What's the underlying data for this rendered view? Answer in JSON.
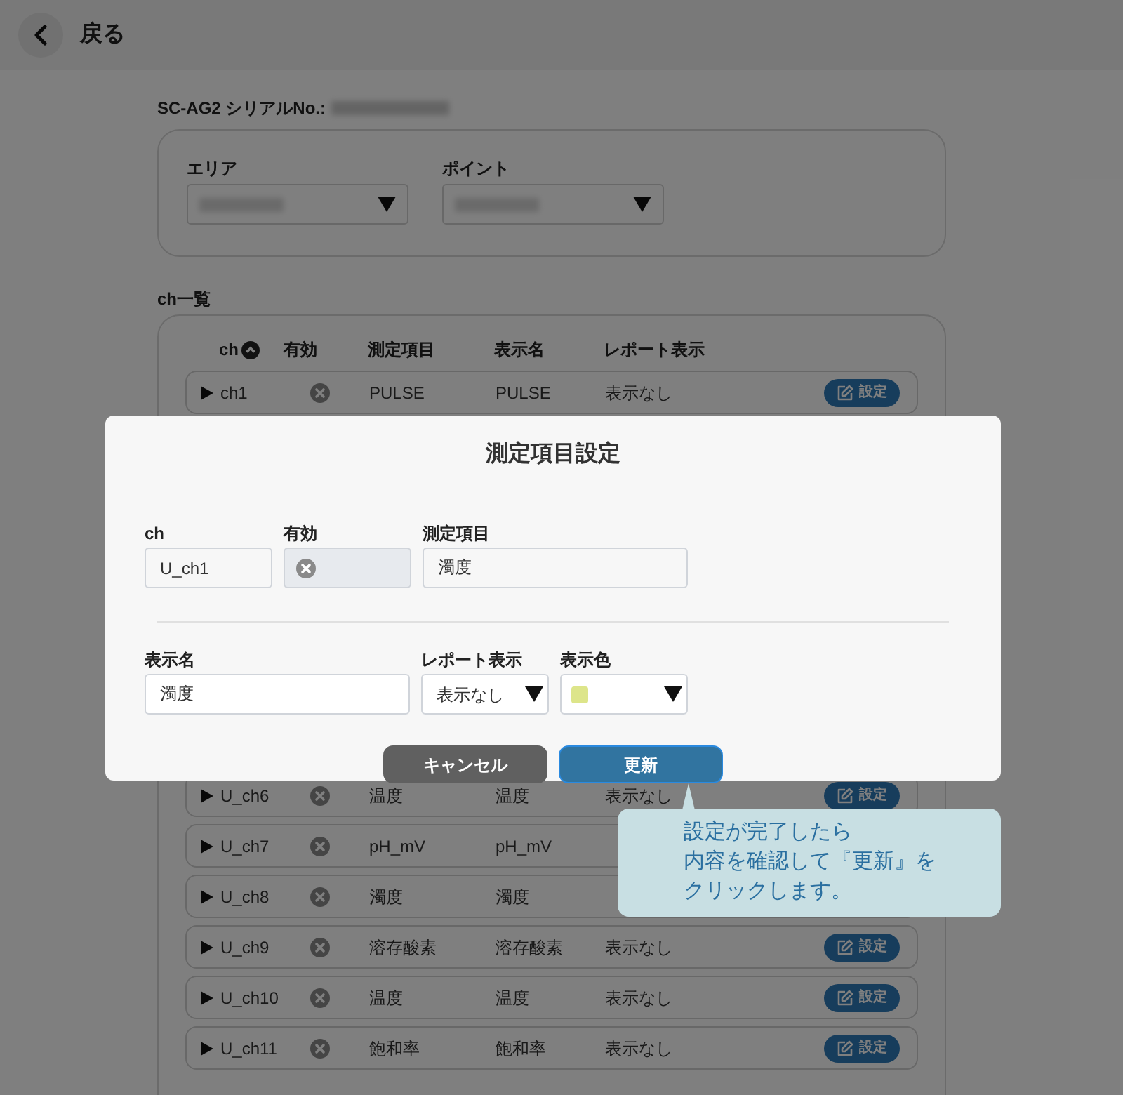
{
  "header": {
    "back_label": "戻る"
  },
  "device": {
    "serial_label": "SC-AG2 シリアルNo.:"
  },
  "filters": [
    {
      "label": "エリア"
    },
    {
      "label": "ポイント"
    }
  ],
  "channel_list": {
    "title": "ch一覧",
    "columns": [
      "ch",
      "有効",
      "測定項目",
      "表示名",
      "レポート表示"
    ],
    "rows": [
      {
        "ch": "ch1",
        "enabled": false,
        "measurement": "PULSE",
        "display_name": "PULSE",
        "report": "表示なし",
        "button": "設定"
      },
      {
        "ch": "U_ch6",
        "enabled": false,
        "measurement": "温度",
        "display_name": "温度",
        "report": "表示なし",
        "button": "設定"
      },
      {
        "ch": "U_ch7",
        "enabled": false,
        "measurement": "pH_mV",
        "display_name": "pH_mV"
      },
      {
        "ch": "U_ch8",
        "enabled": false,
        "measurement": "濁度",
        "display_name": "濁度"
      },
      {
        "ch": "U_ch9",
        "enabled": false,
        "measurement": "溶存酸素",
        "display_name": "溶存酸素",
        "report": "表示なし",
        "button": "設定"
      },
      {
        "ch": "U_ch10",
        "enabled": false,
        "measurement": "温度",
        "display_name": "温度",
        "report": "表示なし",
        "button": "設定"
      },
      {
        "ch": "U_ch11",
        "enabled": false,
        "measurement": "飽和率",
        "display_name": "飽和率",
        "report": "表示なし",
        "button": "設定"
      }
    ]
  },
  "dialog": {
    "title": "測定項目設定",
    "ch": {
      "label": "ch",
      "value": "U_ch1"
    },
    "enabled": {
      "label": "有効",
      "value": false
    },
    "measurement": {
      "label": "測定項目",
      "value": "濁度"
    },
    "display_name": {
      "label": "表示名",
      "value": "濁度"
    },
    "report": {
      "label": "レポート表示",
      "value": "表示なし"
    },
    "display_color": {
      "label": "表示色",
      "color": "#dde58a"
    },
    "buttons": [
      {
        "kind": "cancel",
        "label": "キャンセル"
      },
      {
        "kind": "primary",
        "label": "更新"
      }
    ]
  },
  "callout": {
    "lines": [
      "設定が完了したら",
      "内容を確認して『更新』を",
      "クリックします。"
    ]
  }
}
